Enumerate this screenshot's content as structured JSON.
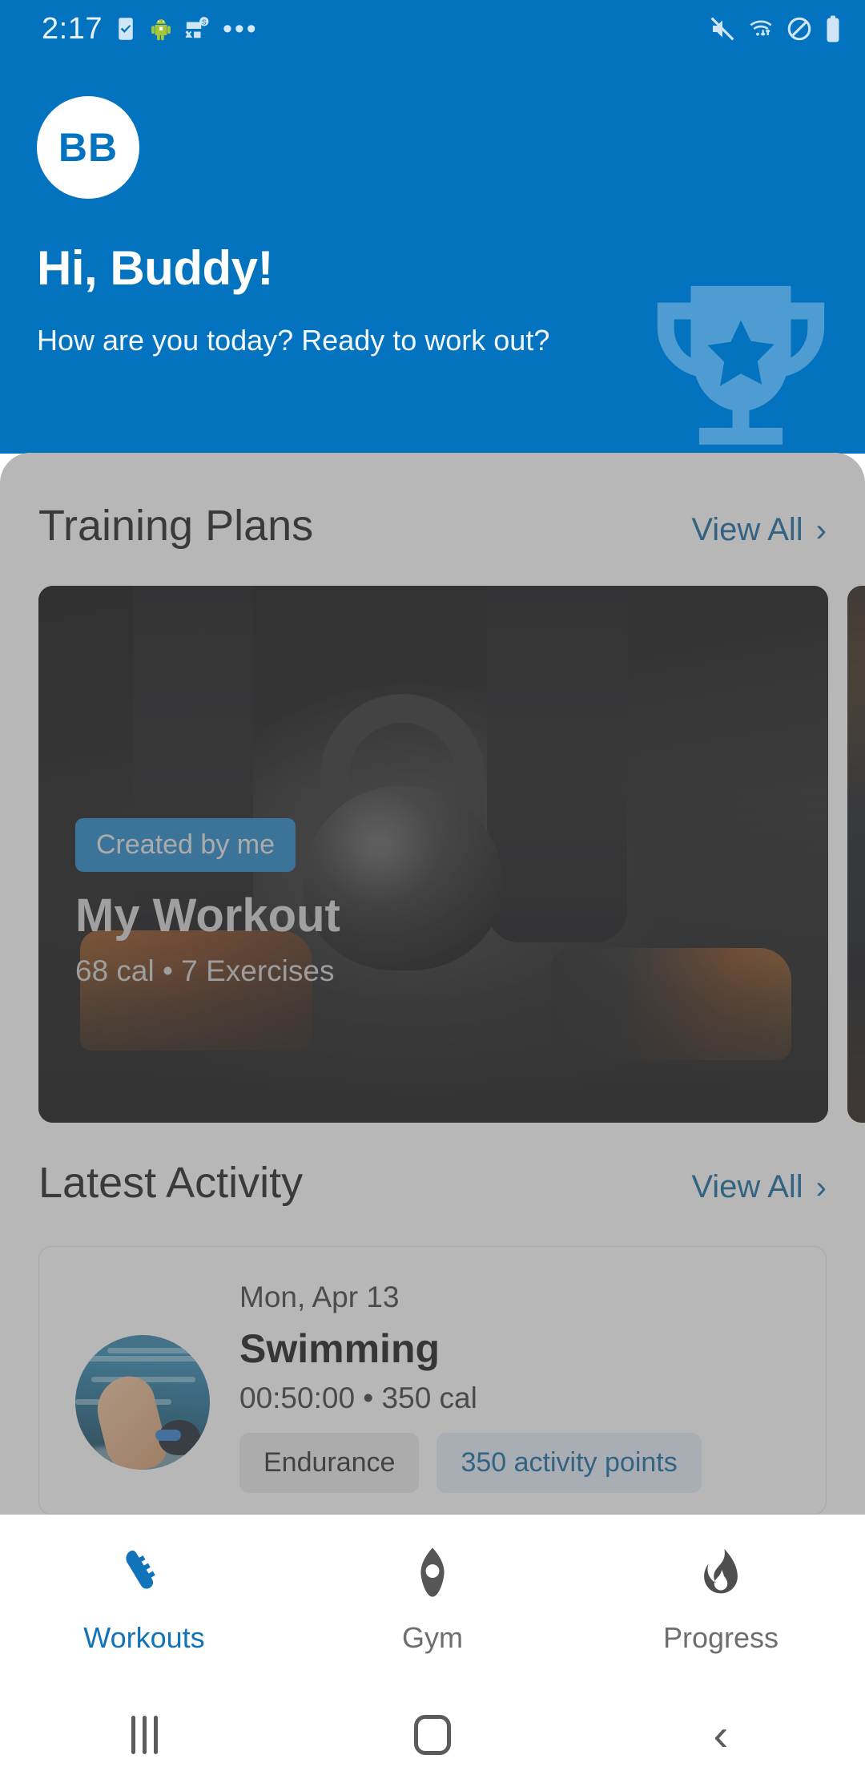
{
  "status_bar": {
    "time": "2:17",
    "left_icons": [
      "phone-check-icon",
      "android-robot-icon",
      "message-error-icon",
      "more-dots-icon"
    ],
    "right_icons": [
      "mute-icon",
      "wifi-transfer-icon",
      "do-not-disturb-icon",
      "battery-icon"
    ]
  },
  "header": {
    "avatar_initials": "BB",
    "title": "Hi, Buddy!",
    "subtitle": "How are you today? Ready to work out?",
    "watermark_icon": "trophy-icon",
    "background_color": "#0372BF"
  },
  "training_plans": {
    "title": "Training Plans",
    "view_all_label": "View All",
    "chevron": "›",
    "cards": [
      {
        "badge": "Created by me",
        "name": "My Workout",
        "meta": "68 cal • 7 Exercises",
        "badge_color": "#1E86C6"
      },
      {
        "badge": "",
        "name": "",
        "meta": ""
      }
    ]
  },
  "latest_activity": {
    "title": "Latest Activity",
    "view_all_label": "View All",
    "chevron": "›",
    "items": [
      {
        "date": "Mon, Apr 13",
        "name": "Swimming",
        "meta": "00:50:00 • 350 cal",
        "tag": "Endurance",
        "points_tag": "350 activity points",
        "thumbnail": "swimmer-photo"
      }
    ]
  },
  "bottom_nav": {
    "active_color": "#1173BA",
    "inactive_color": "#6e6e6e",
    "items": [
      {
        "label": "Workouts",
        "icon": "running-shoe-icon",
        "active": true
      },
      {
        "label": "Gym",
        "icon": "location-pin-icon",
        "active": false
      },
      {
        "label": "Progress",
        "icon": "flame-icon",
        "active": false
      }
    ]
  },
  "android_nav": {
    "recents": "recents-icon",
    "home": "home-icon",
    "back": "back-icon"
  }
}
